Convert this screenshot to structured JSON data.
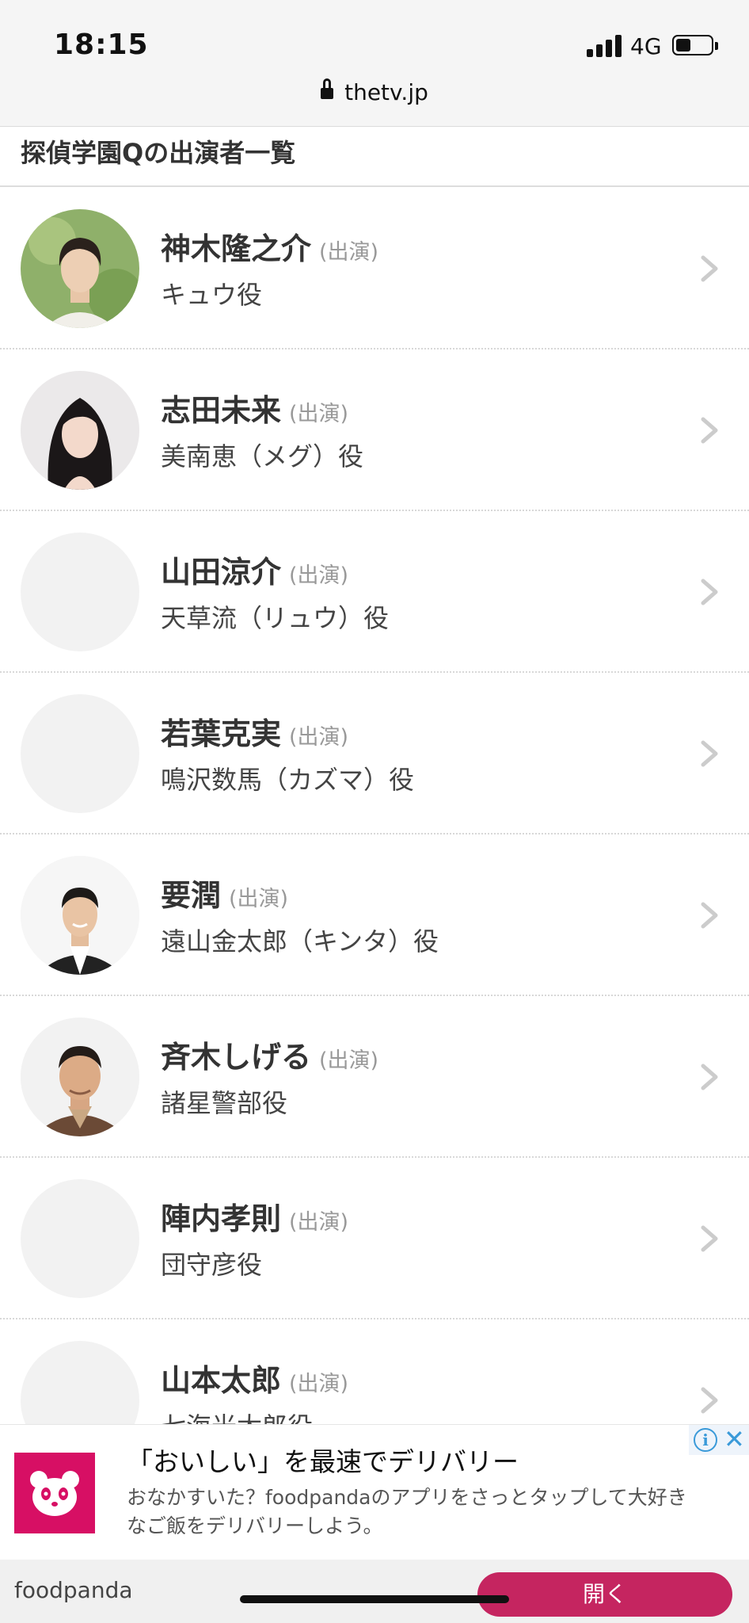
{
  "status_bar": {
    "time": "18:15",
    "network": "4G"
  },
  "browser": {
    "url": "thetv.jp"
  },
  "page": {
    "title": "探偵学園Qの出演者一覧"
  },
  "cast": [
    {
      "name": "神木隆之介",
      "type": "(出演)",
      "role": "キュウ役",
      "photo": "young-man"
    },
    {
      "name": "志田未来",
      "type": "(出演)",
      "role": "美南恵（メグ）役",
      "photo": "young-woman"
    },
    {
      "name": "山田涼介",
      "type": "(出演)",
      "role": "天草流（リュウ）役",
      "photo": "none"
    },
    {
      "name": "若葉克実",
      "type": "(出演)",
      "role": "鳴沢数馬（カズマ）役",
      "photo": "none"
    },
    {
      "name": "要潤",
      "type": "(出演)",
      "role": "遠山金太郎（キンタ）役",
      "photo": "man-suit"
    },
    {
      "name": "斉木しげる",
      "type": "(出演)",
      "role": "諸星警部役",
      "photo": "older-man"
    },
    {
      "name": "陣内孝則",
      "type": "(出演)",
      "role": "団守彦役",
      "photo": "none"
    },
    {
      "name": "山本太郎",
      "type": "(出演)",
      "role": "七海光太郎役",
      "photo": "none"
    }
  ],
  "ad": {
    "headline": "「おいしい」を最速でデリバリー",
    "description": "おなかすいた？foodpandaのアプリをさっとタップして大好きなご飯をデリバリーしよう。",
    "brand": "foodpanda",
    "cta": "開く",
    "brand_color": "#d70f64",
    "cta_color": "#c52560"
  }
}
